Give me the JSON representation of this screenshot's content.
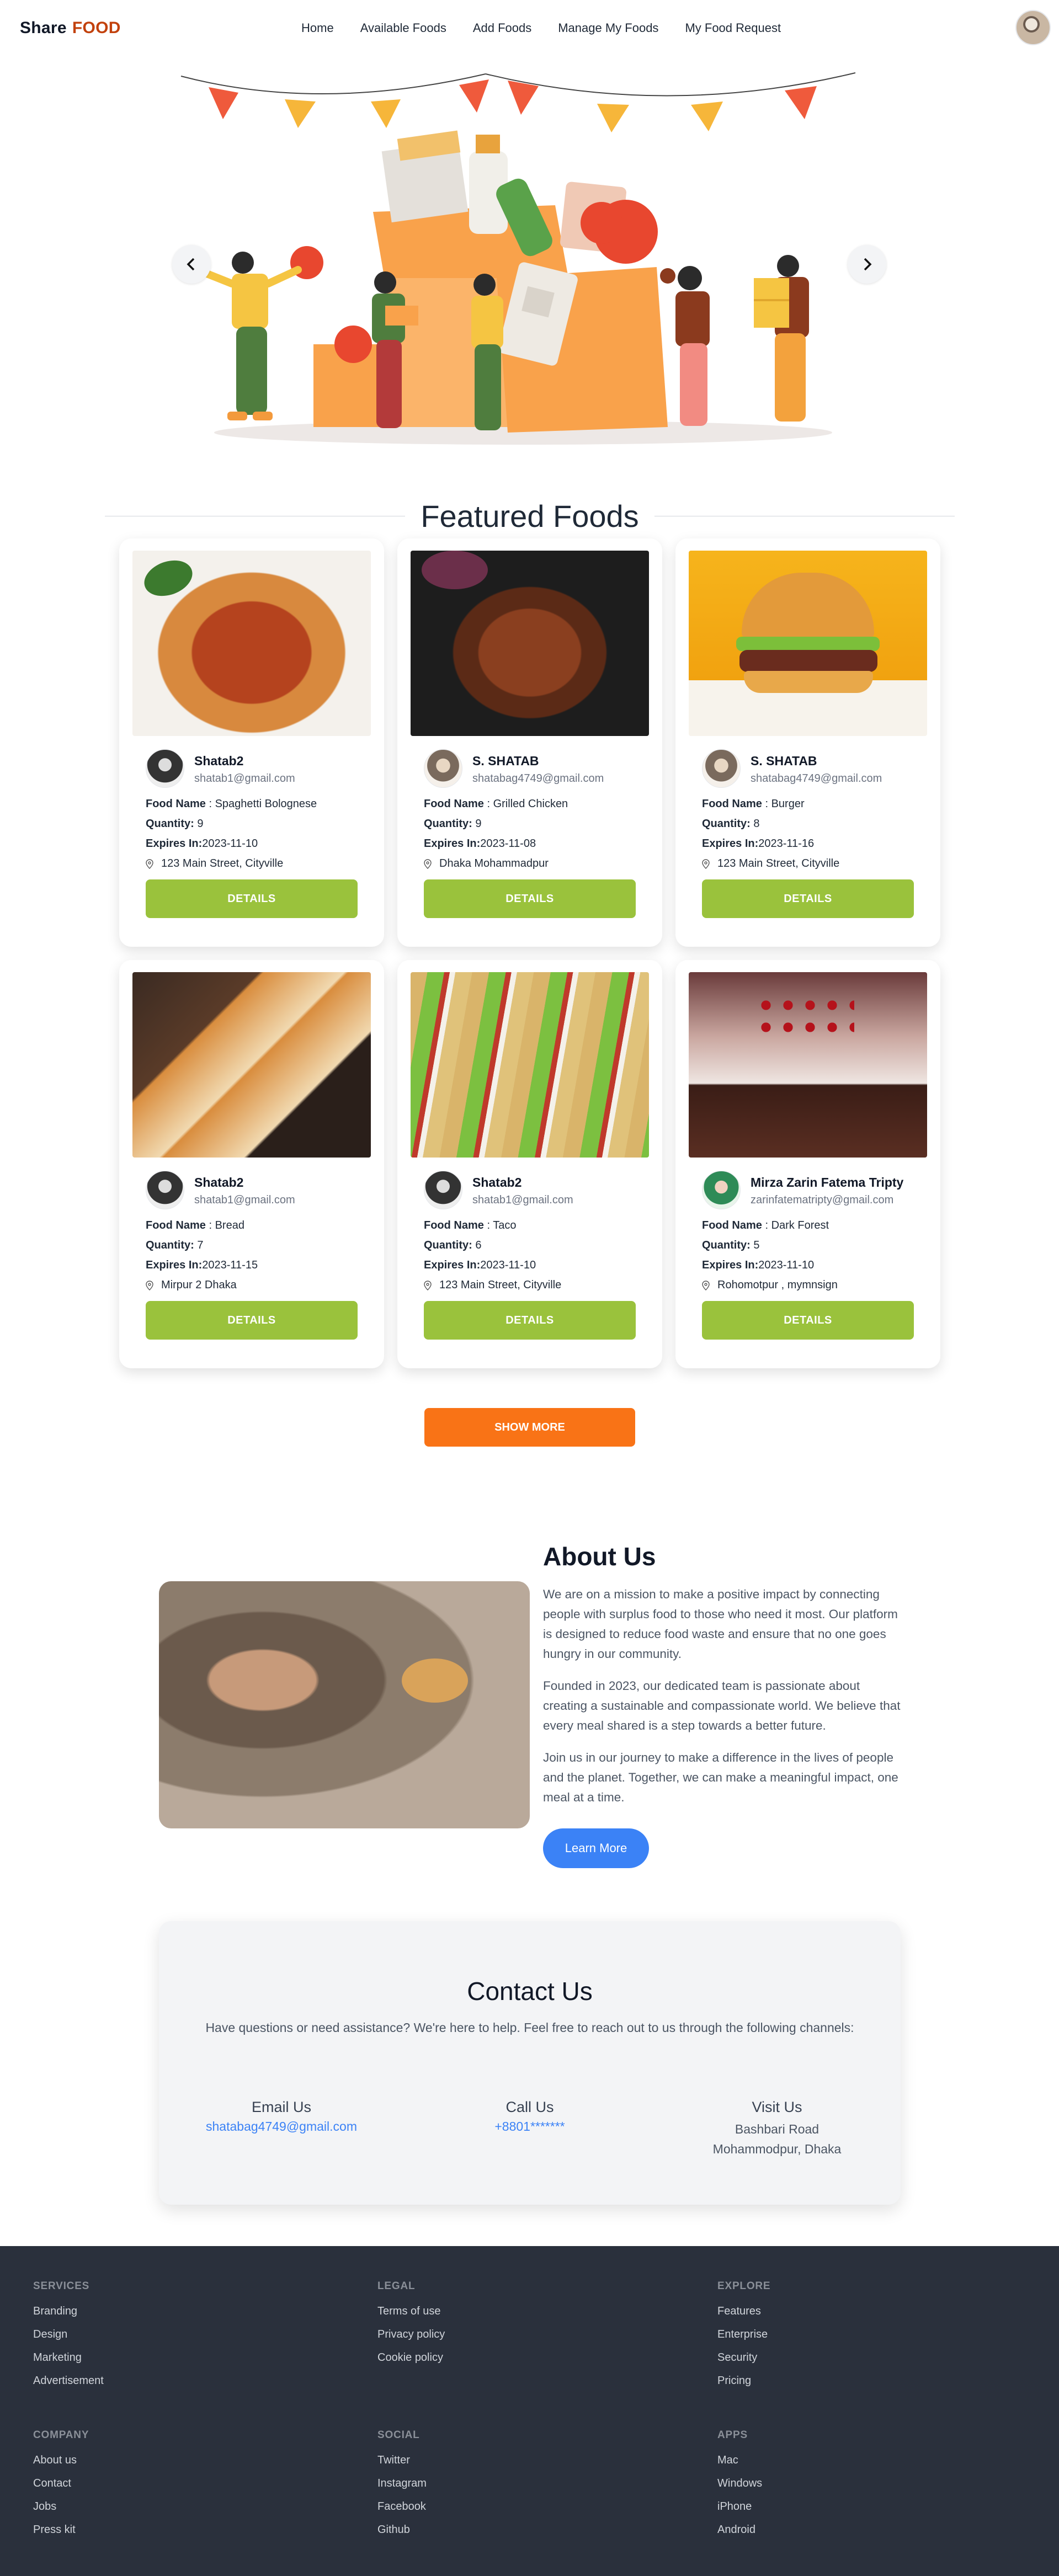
{
  "nav": {
    "brand_a": "Share",
    "brand_b": "FOOD",
    "links": [
      "Home",
      "Available Foods",
      "Add Foods",
      "Manage My Foods",
      "My Food Request"
    ]
  },
  "hero": {
    "prev_icon": "chevron-left-icon",
    "next_icon": "chevron-right-icon"
  },
  "featured": {
    "title": "Featured Foods",
    "labels": {
      "food_name": "Food Name",
      "quantity": "Quantity:",
      "expires": "Expires In:",
      "details": "DETAILS"
    },
    "cards": [
      {
        "name": "Shatab2",
        "email": "shatab1@gmail.com",
        "food": "Spaghetti Bolognese",
        "qty": "9",
        "exp": "2023-11-10",
        "loc": "123 Main Street, Cityville"
      },
      {
        "name": "S. SHATAB",
        "email": "shatabag4749@gmail.com",
        "food": "Grilled Chicken",
        "qty": "9",
        "exp": "2023-11-08",
        "loc": "Dhaka Mohammadpur"
      },
      {
        "name": "S. SHATAB",
        "email": "shatabag4749@gmail.com",
        "food": "Burger",
        "qty": "8",
        "exp": "2023-11-16",
        "loc": "123 Main Street, Cityville"
      },
      {
        "name": "Shatab2",
        "email": "shatab1@gmail.com",
        "food": "Bread",
        "qty": "7",
        "exp": "2023-11-15",
        "loc": "Mirpur 2 Dhaka"
      },
      {
        "name": "Shatab2",
        "email": "shatab1@gmail.com",
        "food": "Taco",
        "qty": "6",
        "exp": "2023-11-10",
        "loc": "123 Main Street, Cityville"
      },
      {
        "name": "Mirza Zarin Fatema Tripty",
        "email": "zarinfatematripty@gmail.com",
        "food": "Dark Forest",
        "qty": "5",
        "exp": "2023-11-10",
        "loc": "Rohomotpur , mymnsign"
      }
    ],
    "show_more": "SHOW MORE"
  },
  "about": {
    "title": "About Us",
    "p1": "We are on a mission to make a positive impact by connecting people with surplus food to those who need it most. Our platform is designed to reduce food waste and ensure that no one goes hungry in our community.",
    "p2": "Founded in 2023, our dedicated team is passionate about creating a sustainable and compassionate world. We believe that every meal shared is a step towards a better future.",
    "p3": "Join us in our journey to make a difference in the lives of people and the planet. Together, we can make a meaningful impact, one meal at a time.",
    "button": "Learn More"
  },
  "contact": {
    "title": "Contact Us",
    "subtitle": "Have questions or need assistance? We're here to help. Feel free to reach out to us through the following channels:",
    "email_h": "Email Us",
    "email_v": "shatabag4749@gmail.com",
    "call_h": "Call Us",
    "call_v": "+8801*******",
    "visit_h": "Visit Us",
    "visit_v1": "Bashbari Road",
    "visit_v2": "Mohammodpur, Dhaka"
  },
  "footer": {
    "services": {
      "title": "SERVICES",
      "items": [
        "Branding",
        "Design",
        "Marketing",
        "Advertisement"
      ]
    },
    "legal": {
      "title": "LEGAL",
      "items": [
        "Terms of use",
        "Privacy policy",
        "Cookie policy"
      ]
    },
    "explore": {
      "title": "EXPLORE",
      "items": [
        "Features",
        "Enterprise",
        "Security",
        "Pricing"
      ]
    },
    "company": {
      "title": "COMPANY",
      "items": [
        "About us",
        "Contact",
        "Jobs",
        "Press kit"
      ]
    },
    "social": {
      "title": "SOCIAL",
      "items": [
        "Twitter",
        "Instagram",
        "Facebook",
        "Github"
      ]
    },
    "apps": {
      "title": "APPS",
      "items": [
        "Mac",
        "Windows",
        "iPhone",
        "Android"
      ]
    }
  },
  "colors": {
    "brand_orange": "#c2410c",
    "details_green": "#9ac23c",
    "show_more_orange": "#f97316",
    "learn_more_blue": "#3b82f6",
    "footer_bg": "#2a303c"
  }
}
